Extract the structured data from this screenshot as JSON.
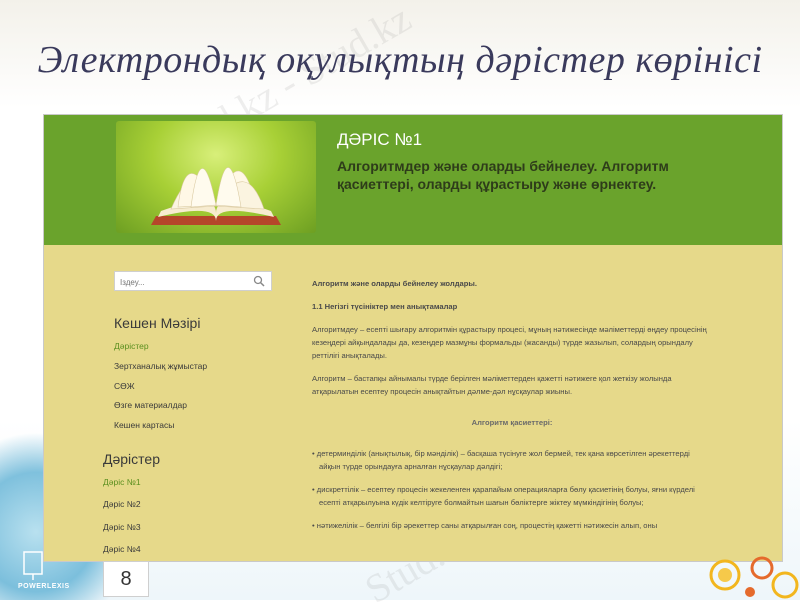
{
  "slide": {
    "title": "Электрондық оқулықтың дәрістер көрінісі",
    "page_number": "8",
    "logo_text": "POWERLEXIS",
    "watermark": "Stud.kz - Stud.kz"
  },
  "header": {
    "lesson_number": "ДӘРІС №1",
    "lesson_title": "Алгоритмдер және оларды бейнелеу. Алгоритм қасиеттері, оларды құрастыру және өрнектеу."
  },
  "search": {
    "placeholder": "Іздеу..."
  },
  "menu": {
    "heading": "Кешен Мәзірі",
    "items": [
      {
        "label": "Дәрістер"
      },
      {
        "label": "Зертханалық жұмыстар"
      },
      {
        "label": "СӨЖ"
      },
      {
        "label": "Өзге материалдар"
      },
      {
        "label": "Кешен картасы"
      }
    ]
  },
  "lectures": {
    "heading": "Дәрістер",
    "items": [
      {
        "label": "Дәріс №1"
      },
      {
        "label": "Дәріс №2"
      },
      {
        "label": "Дәріс №3"
      },
      {
        "label": "Дәріс №4"
      }
    ]
  },
  "content": {
    "heading": "Алгоритм және оларды бейнелеу жолдары.",
    "subheading": "1.1 Негізгі түсініктер мен анықтамалар",
    "para1": "Алгоритмдеу – есепті шығару алгоритмін құрастыру процесі, мұның нәтижесінде мәліметтерді өңдеу процесінің кезеңдері айқындалады да, кезеңдер мазмұны формальды (жасанды) түрде жазылып, солардың орындалу реттілігі анықталады.",
    "para2": "Алгоритм – бастапқы айнымалы түрде берілген мәліметтерден қажетті нәтижеге қол жеткізу жолында атқарылатын есептеу процесін анықтайтын дәлме-дәл нұсқаулар жиыны.",
    "properties_heading": "Алгоритм қасиеттері:",
    "bullet1": "детерминділік (анықтылық, бір мәнділік) – басқаша түсінуге жол бермей, тек қана көрсетілген әрекеттерді айқын түрде орындауға арналған нұсқаулар дәлдігі;",
    "bullet2": "дискреттілік – есептеу процесін жекеленген қарапайым операцияларға бөлу қасиетінің болуы, яғни күрделі есепті атқарылуына күдік келтіруге болмайтын шағын бөліктерге жіктеу мүмкіндігінің болуы;",
    "bullet3": "нәтижелілік – белгілі бір әрекеттер саны атқарылған соң, процестің қажетті нәтижесін алып, оны"
  },
  "colors": {
    "header_green": "#6aa32c",
    "body_yellow": "#e6d98a",
    "active_link": "#5a8f1e"
  }
}
